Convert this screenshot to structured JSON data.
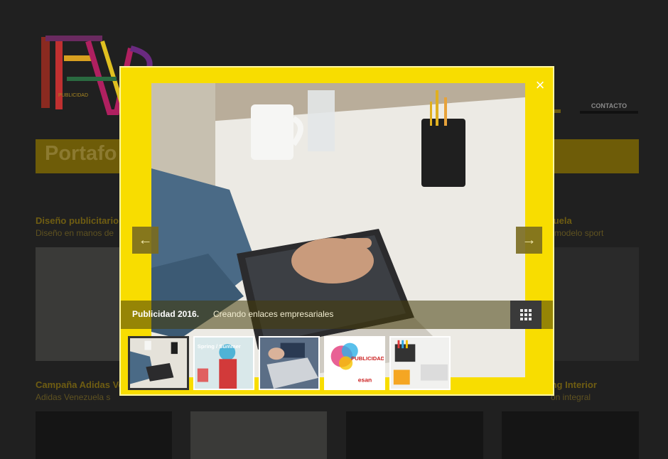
{
  "header": {
    "nav_contact": "CONTACTO"
  },
  "portfolio": {
    "title": "Portafo",
    "cards_row1": [
      {
        "title": "Diseño publicitario",
        "subtitle": "Diseño en manos de"
      },
      {
        "title": "ezuela",
        "subtitle": "modelo sport"
      }
    ],
    "cards_row2": [
      {
        "title": "Campaña Adidas Ve",
        "subtitle": "Adidas Venezuela s"
      },
      {
        "title": "ing Interior",
        "subtitle": "ón integral"
      }
    ]
  },
  "lightbox": {
    "caption_title": "Publicidad 2016.",
    "caption_text": "Creando enlaces empresariales",
    "close_glyph": "×",
    "prev_glyph": "←",
    "next_glyph": "→",
    "accent_color": "#f8dd00",
    "thumbnails": [
      {
        "label": "tablet-desk",
        "active": true
      },
      {
        "label": "Spring / Summer",
        "active": false
      },
      {
        "label": "laptop-typing",
        "active": false
      },
      {
        "label": "PUBLICIDAD",
        "active": false
      },
      {
        "label": "office-supplies",
        "active": false
      }
    ],
    "thumb_texts": {
      "spring": "Spring / Summer",
      "publicidad": "PUBLICIDAD",
      "esan": "esan"
    }
  }
}
